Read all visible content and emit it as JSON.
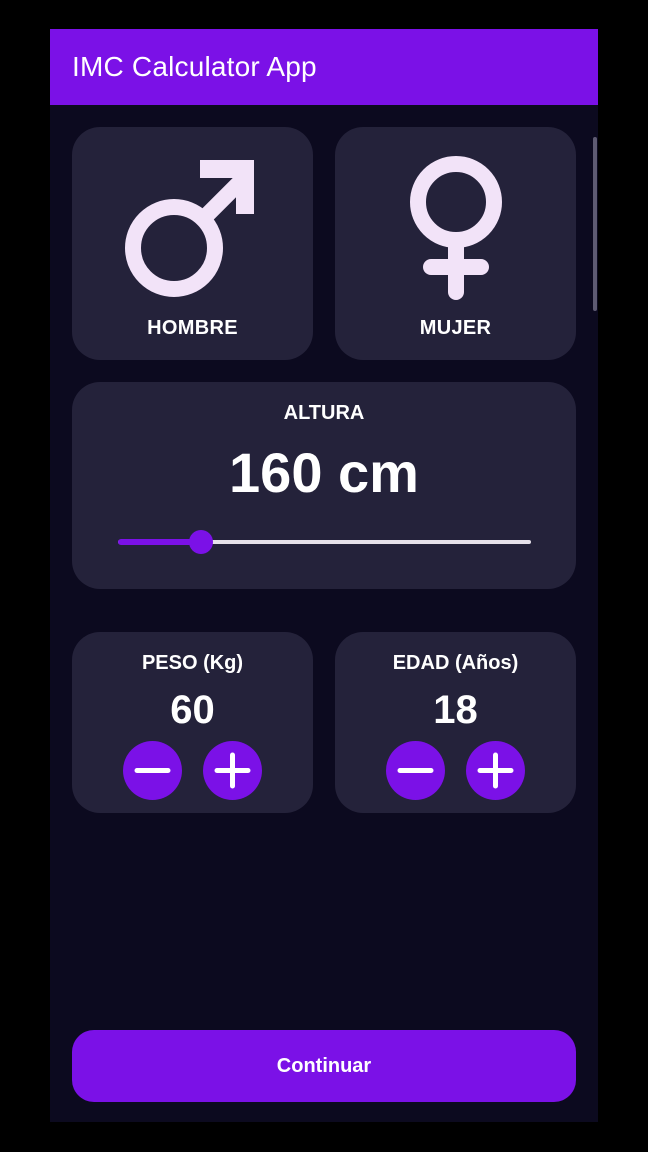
{
  "app_bar": {
    "title": "IMC Calculator App"
  },
  "gender": {
    "male": {
      "label": "HOMBRE",
      "icon": "male-symbol-icon"
    },
    "female": {
      "label": "MUJER",
      "icon": "female-symbol-icon"
    }
  },
  "height": {
    "label": "ALTURA",
    "value_text": "160 cm",
    "slider_fraction": 0.2
  },
  "weight": {
    "label": "PESO (Kg)",
    "value": "60",
    "minus_icon": "minus-icon",
    "plus_icon": "plus-icon"
  },
  "age": {
    "label": "EDAD (Años)",
    "value": "18",
    "minus_icon": "minus-icon",
    "plus_icon": "plus-icon"
  },
  "continue_label": "Continuar",
  "colors": {
    "accent": "#7b11e7",
    "background": "#0c0a1f",
    "card": "#24223a",
    "icon_fill": "#f2e3f8",
    "slider_track": "#e6e1ea"
  }
}
